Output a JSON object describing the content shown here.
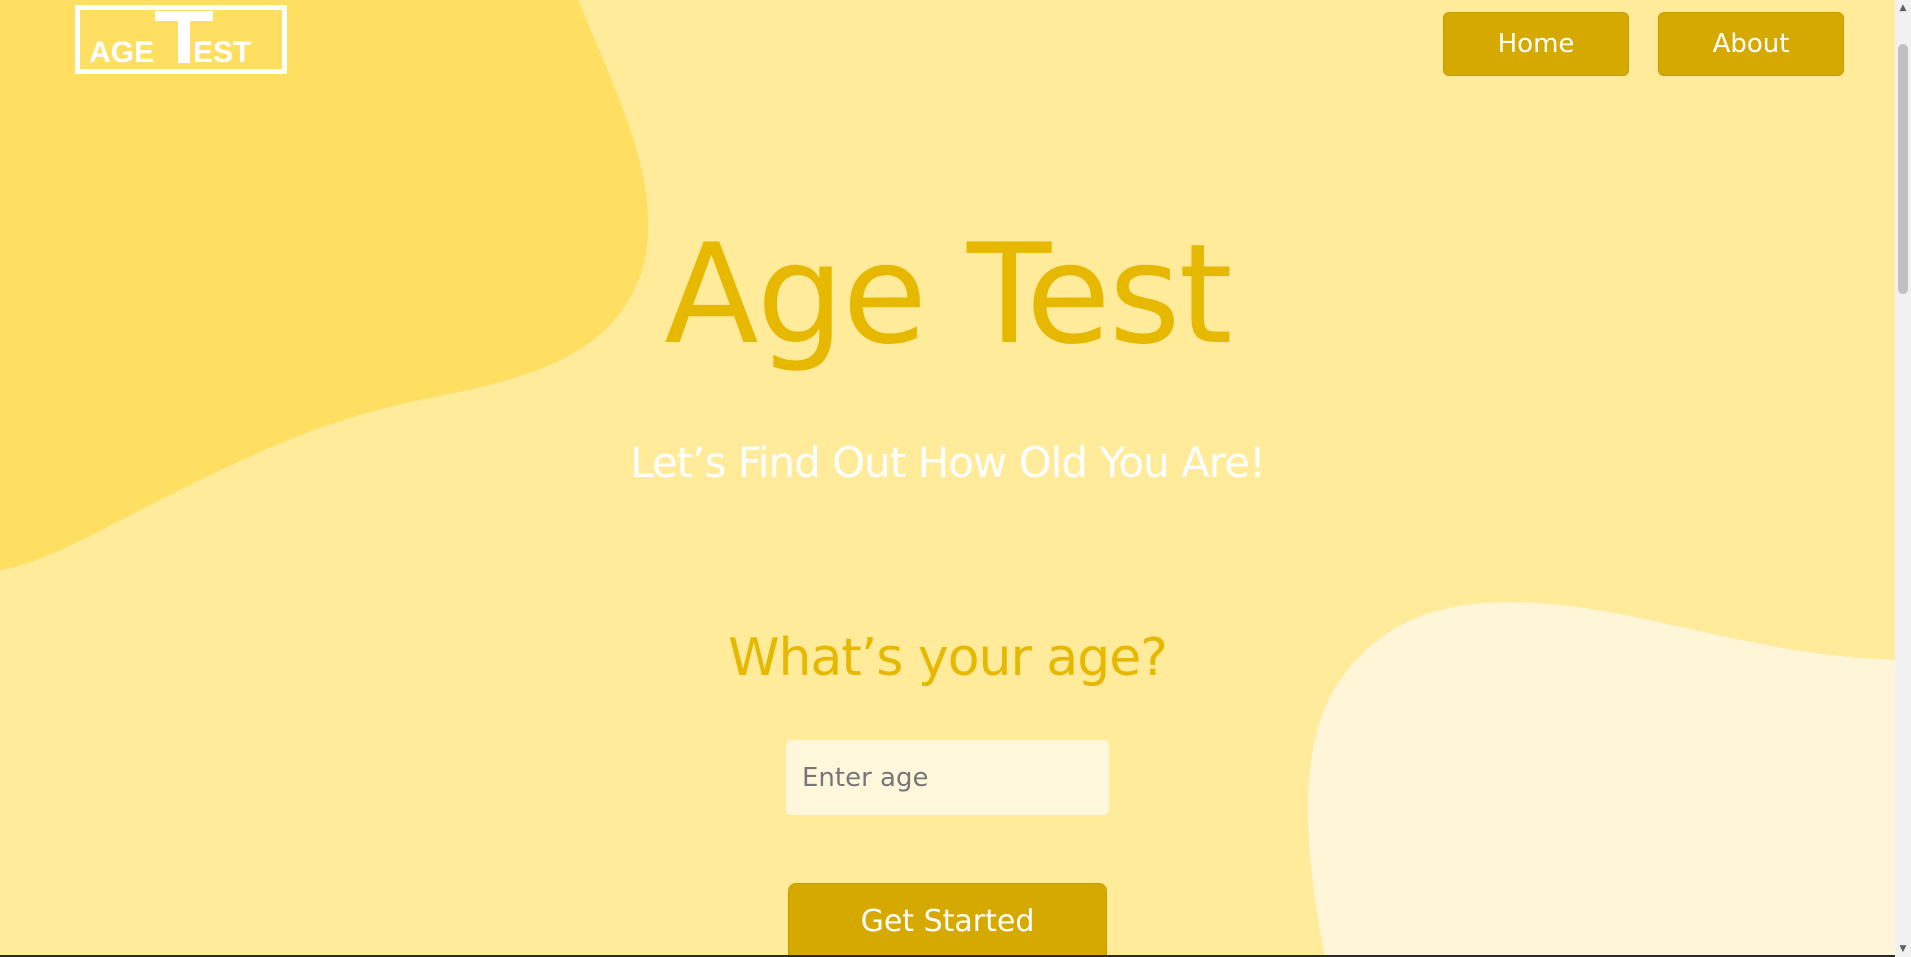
{
  "brand": {
    "logo_text": "AGE TEST"
  },
  "nav": {
    "home_label": "Home",
    "about_label": "About"
  },
  "hero": {
    "title": "Age Test",
    "subtitle": "Let’s Find Out How Old You Are!"
  },
  "form": {
    "question": "What’s your age?",
    "age_placeholder": "Enter age",
    "age_value": "",
    "submit_label": "Get Started"
  },
  "colors": {
    "background": "#ffeb99",
    "blob_dark": "#ffdf62",
    "blob_light": "#fff6d8",
    "accent": "#e6b800",
    "button": "#d6a900",
    "text_light": "#ffffff"
  },
  "icons": {
    "scroll_up": "scroll-up-arrow-icon",
    "scroll_down": "scroll-down-arrow-icon"
  }
}
